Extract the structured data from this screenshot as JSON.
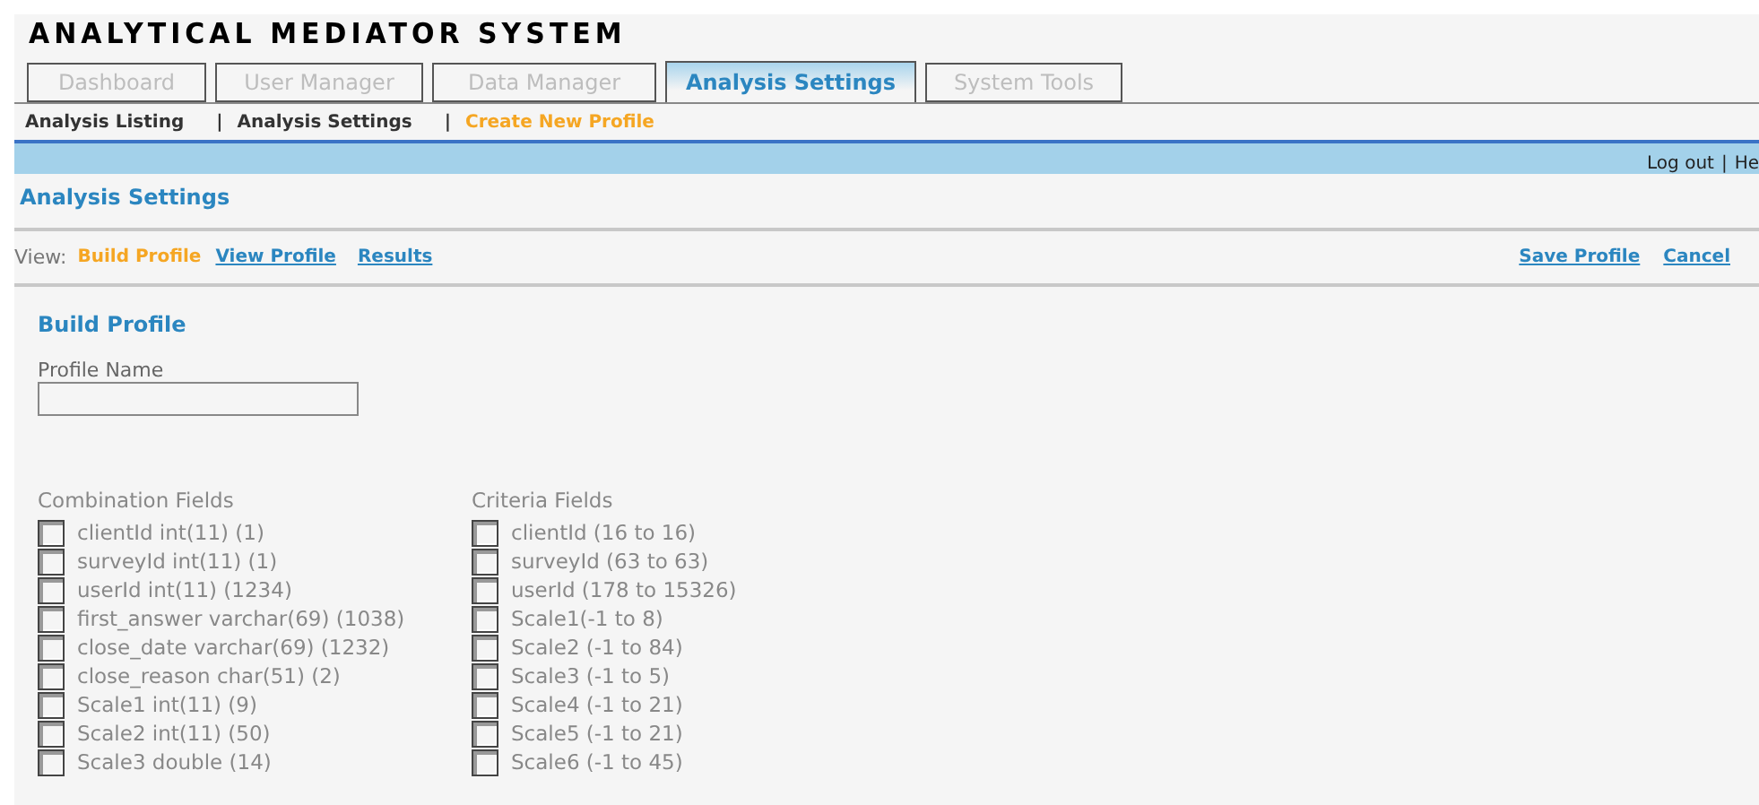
{
  "app_title": "ANALYTICAL MEDIATOR SYSTEM",
  "tabs": [
    {
      "label": "Dashboard",
      "selected": false
    },
    {
      "label": "User Manager",
      "selected": false
    },
    {
      "label": "Data Manager",
      "selected": false
    },
    {
      "label": "Analysis Settings",
      "selected": true
    },
    {
      "label": "System Tools",
      "selected": false
    }
  ],
  "subnav": [
    {
      "label": "Analysis Listing",
      "selected": false
    },
    {
      "label": "Analysis Settings",
      "selected": false
    },
    {
      "label": "Create New Profile",
      "selected": true
    }
  ],
  "subnav_separator": "|",
  "top_bar": {
    "links": [
      "Log out",
      "He"
    ],
    "separator": "|"
  },
  "page_title": "Analysis Settings",
  "view_bar": {
    "label": "View:",
    "views": [
      {
        "label": "Build Profile",
        "selected": true
      },
      {
        "label": "View Profile",
        "selected": false
      },
      {
        "label": "Results",
        "selected": false
      }
    ],
    "actions": [
      "Save Profile",
      "Cancel"
    ]
  },
  "section_title": "Build Profile",
  "profile_name": {
    "label": "Profile Name"
  },
  "combination_fields": {
    "title": "Combination Fields",
    "items": [
      {
        "label": "clientId int(11) (1)",
        "checked": false
      },
      {
        "label": "surveyId int(11) (1)",
        "checked": false
      },
      {
        "label": "userId int(11) (1234)",
        "checked": false
      },
      {
        "label": "first_answer varchar(69) (1038)",
        "checked": false
      },
      {
        "label": "close_date varchar(69) (1232)",
        "checked": false
      },
      {
        "label": "close_reason char(51) (2)",
        "checked": false
      },
      {
        "label": "Scale1 int(11) (9)",
        "checked": false
      },
      {
        "label": "Scale2 int(11) (50)",
        "checked": false
      },
      {
        "label": "Scale3 double (14)",
        "checked": false
      }
    ]
  },
  "criteria_fields": {
    "title": "Criteria Fields",
    "items": [
      {
        "label": "clientId (16 to 16)",
        "checked": false
      },
      {
        "label": "surveyId (63 to 63)",
        "checked": false
      },
      {
        "label": "userId (178 to 15326)",
        "checked": false
      },
      {
        "label": "Scale1(-1 to 8)",
        "checked": false
      },
      {
        "label": "Scale2 (-1 to 84)",
        "checked": false
      },
      {
        "label": "Scale3 (-1 to 5)",
        "checked": false
      },
      {
        "label": "Scale4 (-1 to 21)",
        "checked": false
      },
      {
        "label": "Scale5 (-1 to 21)",
        "checked": false
      },
      {
        "label": "Scale6 (-1 to 45)",
        "checked": false
      }
    ]
  }
}
